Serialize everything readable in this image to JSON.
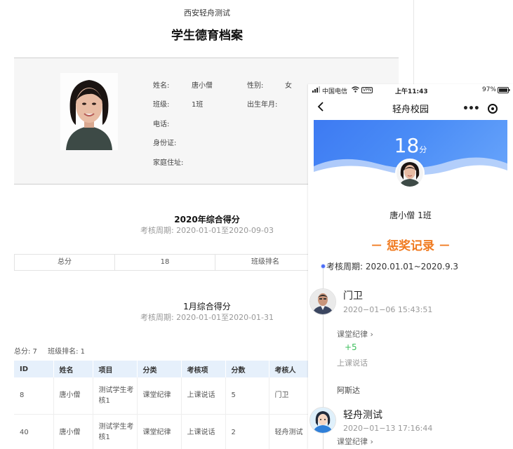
{
  "report": {
    "school_name": "西安轻舟测试",
    "title": "学生德育档案",
    "profile": {
      "name_label": "姓名:",
      "name": "唐小僧",
      "gender_label": "性别:",
      "gender": "女",
      "class_label": "班级:",
      "class": "1班",
      "birth_label": "出生年月:",
      "phone_label": "电话:",
      "id_label": "身份证:",
      "address_label": "家庭住址:"
    },
    "overall": {
      "title": "2020年综合得分",
      "period": "考核周期: 2020-01-01至2020-09-03",
      "cells": [
        "总分",
        "18",
        "班级排名"
      ]
    },
    "month": {
      "title": "1月综合得分",
      "period": "考核周期: 2020-01-01至2020-01-31",
      "total": "总分:  7",
      "rank": "班级排名: 1"
    },
    "table": {
      "headers": [
        "ID",
        "姓名",
        "项目",
        "分类",
        "考核项",
        "分数",
        "考核人"
      ],
      "rows": [
        [
          "8",
          "唐小僧",
          "测试学生考核1",
          "课堂纪律",
          "上课说话",
          "5",
          "门卫"
        ],
        [
          "40",
          "唐小僧",
          "测试学生考核1",
          "课堂纪律",
          "上课说话",
          "2",
          "轻舟测试"
        ]
      ]
    }
  },
  "phone": {
    "status": {
      "carrier": "中国电信",
      "network": "VPN",
      "time": "上午11:43",
      "battery": "97%"
    },
    "nav_title": "轻舟校园",
    "score": "18",
    "score_unit": "分",
    "student": "唐小僧 1班",
    "reward_title": "－ 惩奖记录 －",
    "period": "考核周期:  2020.01.01~2020.9.3",
    "records": [
      {
        "name": "门卫",
        "time": "2020−01−06 15:43:51",
        "category": "课堂纪律 ›",
        "points": "+5",
        "item": "上课说话",
        "note": "阿斯达"
      },
      {
        "name": "轻舟测试",
        "time": "2020−01−13 17:16:44",
        "category": "课堂纪律 ›"
      }
    ]
  },
  "colors": {
    "accent_blue": "#3d7af2",
    "reward_orange": "#f07a1f",
    "points_green": "#3cbf5c",
    "header_bg": "#e6f0fb"
  }
}
